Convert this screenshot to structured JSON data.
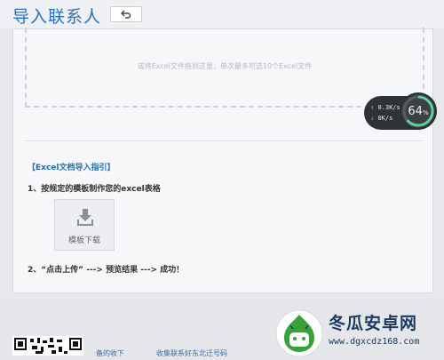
{
  "header": {
    "title": "导入联系人",
    "back_icon": "undo-arrow-icon"
  },
  "dropzone": {
    "hint": "或将Excel文件拖到这里，单次最多可选10个Excel文件"
  },
  "guide": {
    "title": "【Excel文档导入指引】",
    "step1": "1、按规定的模板制作您的excel表格",
    "template_button_label": "模板下载",
    "template_icon": "download-icon",
    "step2": "2、“点击上传” ---> 预览结果 ---> 成功！"
  },
  "speed_widget": {
    "up_speed": "0.3K/s",
    "down_speed": "0K/s",
    "percent_value": "64",
    "percent_unit": "%",
    "percent": 64
  },
  "footer": {
    "text_left": "备的收下",
    "text_right": "收集联系好东北迁号码"
  },
  "watermark": {
    "title": "冬瓜安卓网",
    "url": "www.dgxcdz168.com"
  },
  "colors": {
    "accent": "#2a73b9",
    "watermark": "#1c3b63",
    "logo_green": "#3aa13a"
  }
}
